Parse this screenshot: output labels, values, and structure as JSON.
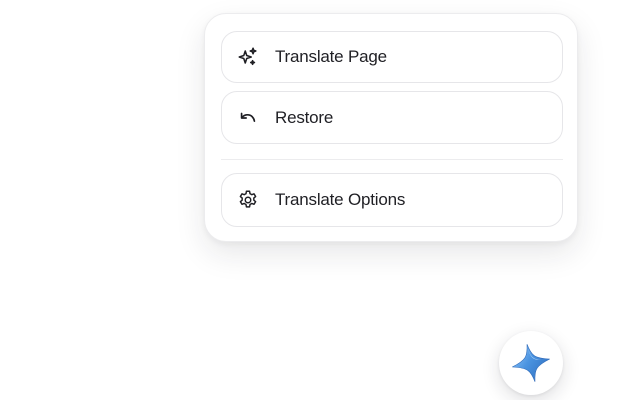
{
  "menu": {
    "items": [
      {
        "label": "Translate Page",
        "icon": "sparkle-icon"
      },
      {
        "label": "Restore",
        "icon": "undo-arrow-icon"
      },
      {
        "label": "Translate Options",
        "icon": "gear-icon"
      }
    ]
  },
  "fab": {
    "icon": "four-point-star-icon",
    "accent_color": "#3b82d6",
    "highlight_color": "#9fd0ff"
  },
  "colors": {
    "text": "#1f1f24",
    "border": "#e6e6e9"
  }
}
